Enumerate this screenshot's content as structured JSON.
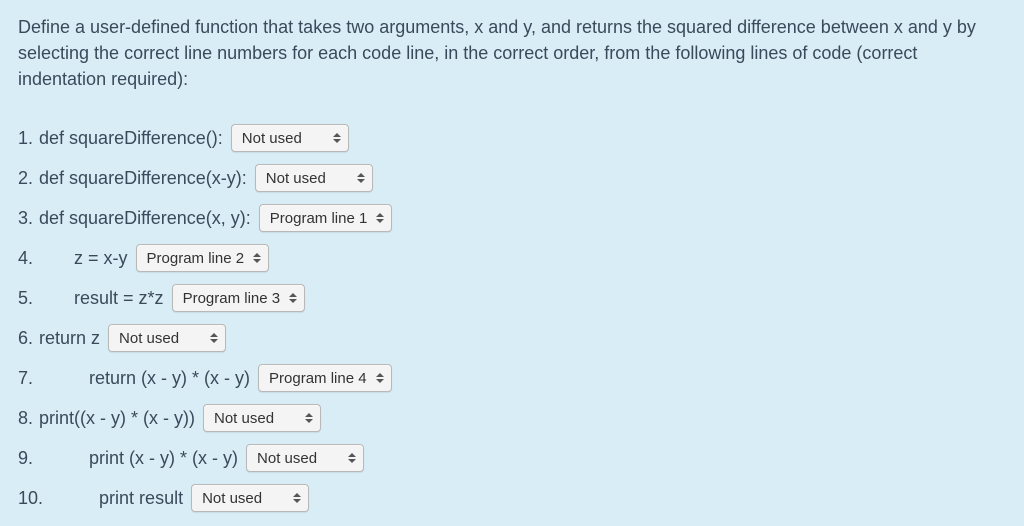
{
  "prompt": "Define a user-defined function that takes two arguments, x and y, and returns the squared difference between x and y by selecting the correct line numbers for each code line, in the correct order, from the following lines of code (correct indentation required):",
  "rows": [
    {
      "num": "1.",
      "code": "def squareDifference():",
      "value": "Not used"
    },
    {
      "num": "2.",
      "code": "def squareDifference(x-y):",
      "value": "Not used"
    },
    {
      "num": "3.",
      "code": "def squareDifference(x, y):",
      "value": "Program line 1"
    },
    {
      "num": "4.",
      "code": "       z = x-y",
      "value": "Program line 2"
    },
    {
      "num": "5.",
      "code": "       result = z*z",
      "value": "Program line 3"
    },
    {
      "num": "6.",
      "code": "return z",
      "value": "Not used"
    },
    {
      "num": "7.",
      "code": "          return (x - y) * (x - y)",
      "value": "Program line 4"
    },
    {
      "num": "8.",
      "code": "print((x - y) * (x - y))",
      "value": "Not used"
    },
    {
      "num": "9.",
      "code": "          print (x - y) * (x - y)",
      "value": "Not used"
    },
    {
      "num": "10.",
      "code": "          print result",
      "value": "Not used"
    }
  ],
  "select_options": [
    "Not used",
    "Program line 1",
    "Program line 2",
    "Program line 3",
    "Program line 4"
  ]
}
